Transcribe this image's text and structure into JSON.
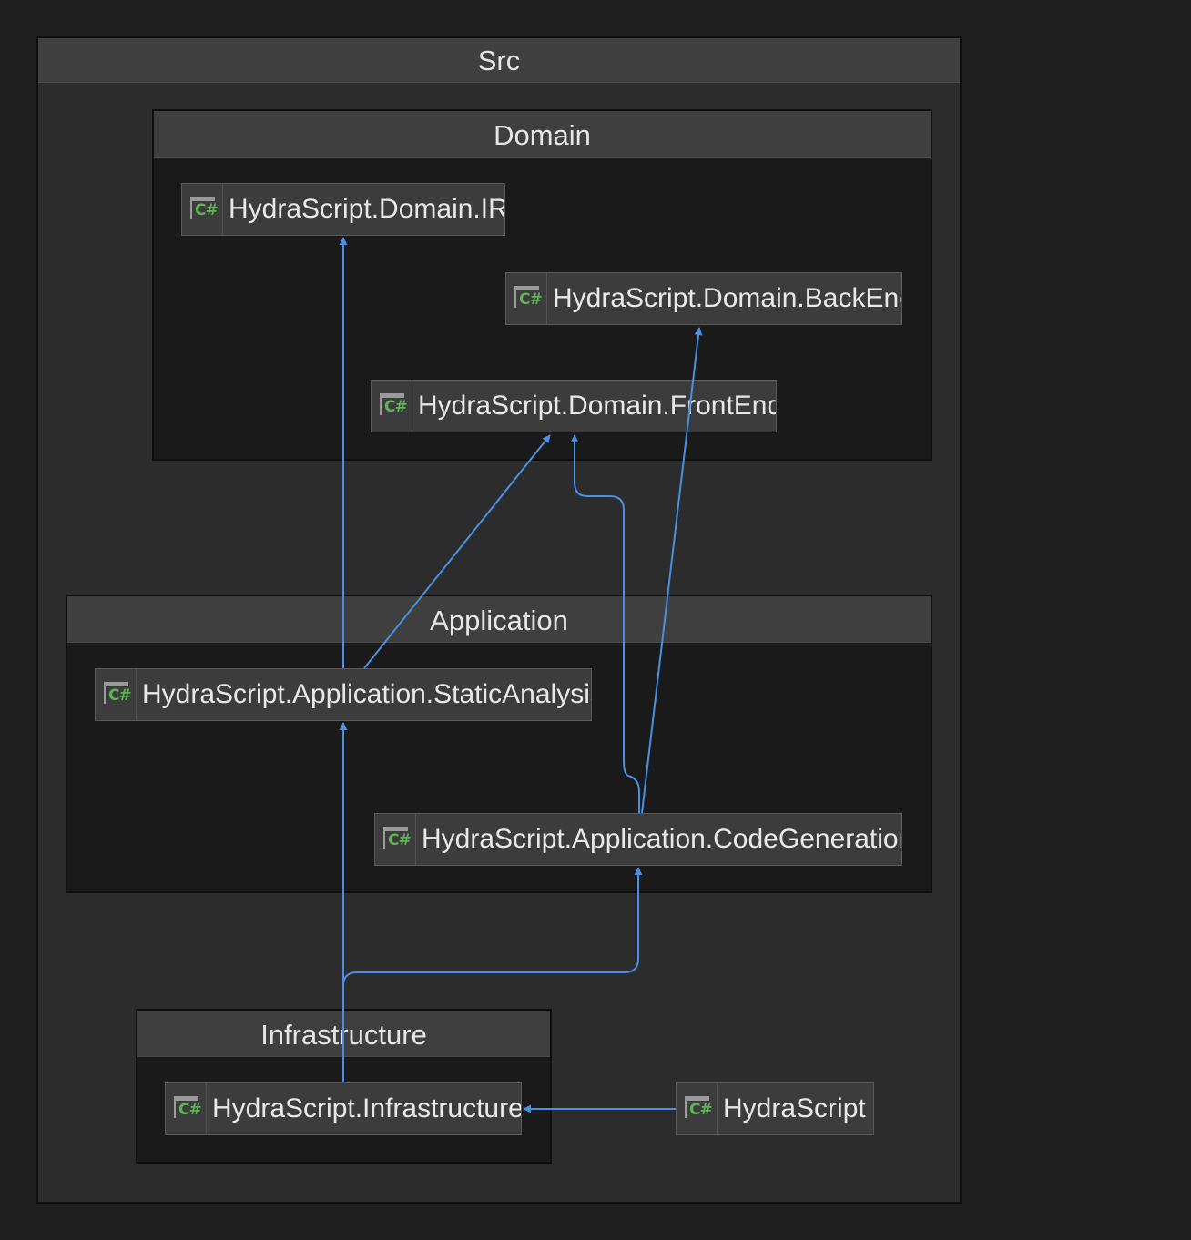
{
  "groups": {
    "src": "Src",
    "domain": "Domain",
    "application": "Application",
    "infrastructure": "Infrastructure"
  },
  "nodes": {
    "domain_ir": "HydraScript.Domain.IR",
    "domain_backend": "HydraScript.Domain.BackEnd",
    "domain_frontend": "HydraScript.Domain.FrontEnd",
    "application_static_analysis": "HydraScript.Application.StaticAnalysis",
    "application_code_generation": "HydraScript.Application.CodeGeneration",
    "infrastructure": "HydraScript.Infrastructure",
    "hydrascript": "HydraScript"
  },
  "icon": {
    "name": "csharp-project-icon",
    "text": "C#",
    "color": "#5ab552"
  },
  "edges": [
    {
      "from": "HydraScript.Application.StaticAnalysis",
      "to": "HydraScript.Domain.IR"
    },
    {
      "from": "HydraScript.Application.StaticAnalysis",
      "to": "HydraScript.Domain.FrontEnd"
    },
    {
      "from": "HydraScript.Application.CodeGeneration",
      "to": "HydraScript.Domain.FrontEnd"
    },
    {
      "from": "HydraScript.Application.CodeGeneration",
      "to": "HydraScript.Domain.BackEnd"
    },
    {
      "from": "HydraScript.Infrastructure",
      "to": "HydraScript.Application.StaticAnalysis"
    },
    {
      "from": "HydraScript.Infrastructure",
      "to": "HydraScript.Application.CodeGeneration"
    },
    {
      "from": "HydraScript",
      "to": "HydraScript.Infrastructure"
    }
  ],
  "colors": {
    "edge": "#4a90e2",
    "background": "#1f1f1f",
    "group_header": "#3f3f3f",
    "node": "#3c3c3c"
  }
}
